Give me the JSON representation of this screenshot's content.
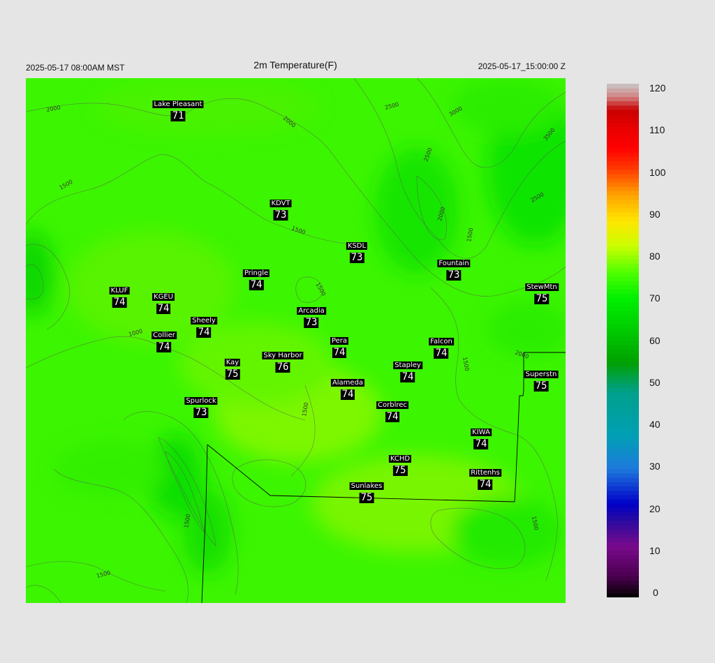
{
  "header": {
    "title": "2m Temperature(F)",
    "left_label": "2025-05-17 08:00AM MST",
    "right_label": "2025-05-17_15:00:00 Z"
  },
  "colorbar": {
    "ticks": [
      "120",
      "110",
      "100",
      "90",
      "80",
      "70",
      "60",
      "50",
      "40",
      "30",
      "20",
      "10",
      "0"
    ],
    "stops": [
      {
        "v": 0,
        "c": "#000000"
      },
      {
        "v": 5,
        "c": "#4b0050"
      },
      {
        "v": 12,
        "c": "#7a0a8c"
      },
      {
        "v": 18,
        "c": "#2a0aa0"
      },
      {
        "v": 22,
        "c": "#0000c8"
      },
      {
        "v": 30,
        "c": "#1e78dc"
      },
      {
        "v": 38,
        "c": "#00a0b4"
      },
      {
        "v": 48,
        "c": "#00a08c"
      },
      {
        "v": 55,
        "c": "#00a000"
      },
      {
        "v": 62,
        "c": "#00c800"
      },
      {
        "v": 70,
        "c": "#00f000"
      },
      {
        "v": 76,
        "c": "#50ff00"
      },
      {
        "v": 82,
        "c": "#c8ff00"
      },
      {
        "v": 88,
        "c": "#ffe600"
      },
      {
        "v": 94,
        "c": "#ffa500"
      },
      {
        "v": 100,
        "c": "#ff3c00"
      },
      {
        "v": 105,
        "c": "#ff0000"
      },
      {
        "v": 110,
        "c": "#e60000"
      },
      {
        "v": 114,
        "c": "#c80000"
      },
      {
        "v": 117,
        "c": "#d28282"
      },
      {
        "v": 120,
        "c": "#c8c8c8"
      }
    ]
  },
  "contour_labels": [
    "2000",
    "2000",
    "2500",
    "3000",
    "3500",
    "2500",
    "2000",
    "1500",
    "1500",
    "1500",
    "1500",
    "1000",
    "2000",
    "1500",
    "1500",
    "1500",
    "2500",
    "1500",
    "1500"
  ],
  "stations": [
    {
      "name": "Lake Pleasant",
      "value": "71"
    },
    {
      "name": "KDVT",
      "value": "73"
    },
    {
      "name": "KSDL",
      "value": "73"
    },
    {
      "name": "Fountain",
      "value": "73"
    },
    {
      "name": "Pringle",
      "value": "74"
    },
    {
      "name": "StewMtn",
      "value": "75"
    },
    {
      "name": "KLUF",
      "value": "74"
    },
    {
      "name": "KGEU",
      "value": "74"
    },
    {
      "name": "Arcadia",
      "value": "73"
    },
    {
      "name": "Sheely",
      "value": "74"
    },
    {
      "name": "Collier",
      "value": "74"
    },
    {
      "name": "Pera",
      "value": "74"
    },
    {
      "name": "Falcon",
      "value": "74"
    },
    {
      "name": "Sky Harbor",
      "value": "76"
    },
    {
      "name": "Kay",
      "value": "75"
    },
    {
      "name": "Stapley",
      "value": "74"
    },
    {
      "name": "Superstn",
      "value": "75"
    },
    {
      "name": "Alameda",
      "value": "74"
    },
    {
      "name": "Spurlock",
      "value": "73"
    },
    {
      "name": "Corblrec",
      "value": "74"
    },
    {
      "name": "KIWA",
      "value": "74"
    },
    {
      "name": "KCHD",
      "value": "75"
    },
    {
      "name": "Rittenhs",
      "value": "74"
    },
    {
      "name": "Sunlakes",
      "value": "75"
    }
  ]
}
